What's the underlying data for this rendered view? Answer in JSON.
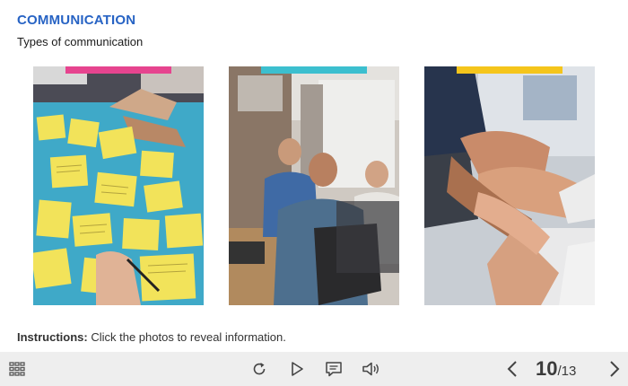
{
  "header": {
    "title": "COMMUNICATION",
    "subtitle": "Types of communication"
  },
  "photos": [
    {
      "name": "photo-sticky-notes",
      "tag_color": "#e6448f",
      "icons": "sticky notes planning"
    },
    {
      "name": "photo-office-meeting",
      "tag_color": "#3cbfcf",
      "icons": "team meeting"
    },
    {
      "name": "photo-joined-hands",
      "tag_color": "#f5c51b",
      "icons": "team hands"
    }
  ],
  "instructions": {
    "label": "Instructions:",
    "text": " Click the photos to reveal information."
  },
  "toolbar": {
    "menu_icon": "grid-menu-icon",
    "replay_icon": "replay-icon",
    "play_icon": "play-icon",
    "transcript_icon": "transcript-icon",
    "audio_icon": "audio-icon",
    "prev_icon": "chevron-left-icon",
    "next_icon": "chevron-right-icon",
    "current_page": "10",
    "total_pages": "/13"
  }
}
